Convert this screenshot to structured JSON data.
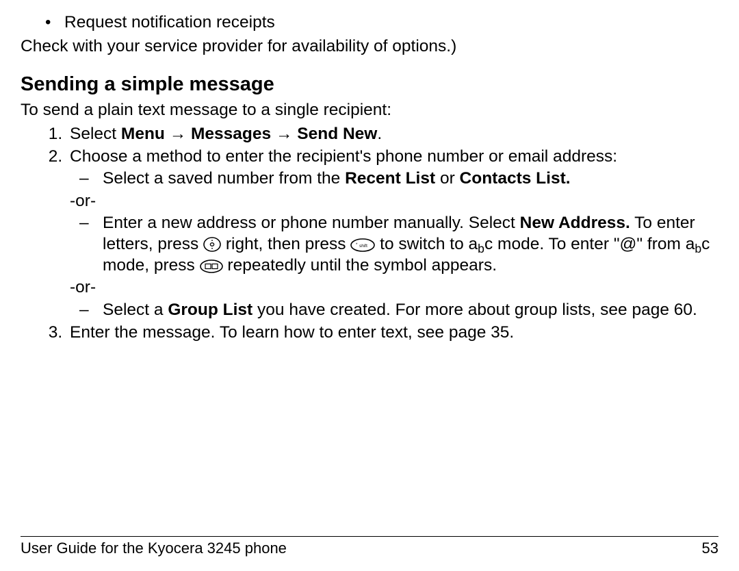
{
  "top_bullet": "Request notification receipts",
  "top_para": "Check with your service provider for availability of options.)",
  "heading": "Sending a simple message",
  "intro": "To send a plain text message to a single recipient:",
  "step1": {
    "prefix": "Select ",
    "menu": "Menu",
    "messages": "Messages",
    "sendnew": "Send New",
    "suffix": "."
  },
  "step2_intro": "Choose a method to enter the recipient's phone number or email address:",
  "step2_opt1_a": "Select a saved number from the ",
  "step2_opt1_b": "Recent List",
  "step2_opt1_c": " or ",
  "step2_opt1_d": "Contacts List.",
  "or": "-or-",
  "step2_opt2_a": "Enter a new address or phone number manually. Select ",
  "step2_opt2_b": "New Address.",
  "step2_opt2_c": " To enter letters, press ",
  "step2_opt2_d": " right, then press ",
  "step2_opt2_e": " to switch to ",
  "step2_opt2_f": " mode. To enter \"@\" from ",
  "step2_opt2_g": " mode, press ",
  "step2_opt2_h": " repeatedly until the symbol appears.",
  "step2_opt3_a": "Select a ",
  "step2_opt3_b": "Group List",
  "step2_opt3_c": " you have created. For more about group lists, see page 60.",
  "step3": "Enter the message. To learn how to enter text, see page 35.",
  "footer_left": "User Guide for the Kyocera 3245 phone",
  "footer_right": "53",
  "arrow": "→",
  "abc": {
    "a": "a",
    "b": "b",
    "c": "c"
  }
}
